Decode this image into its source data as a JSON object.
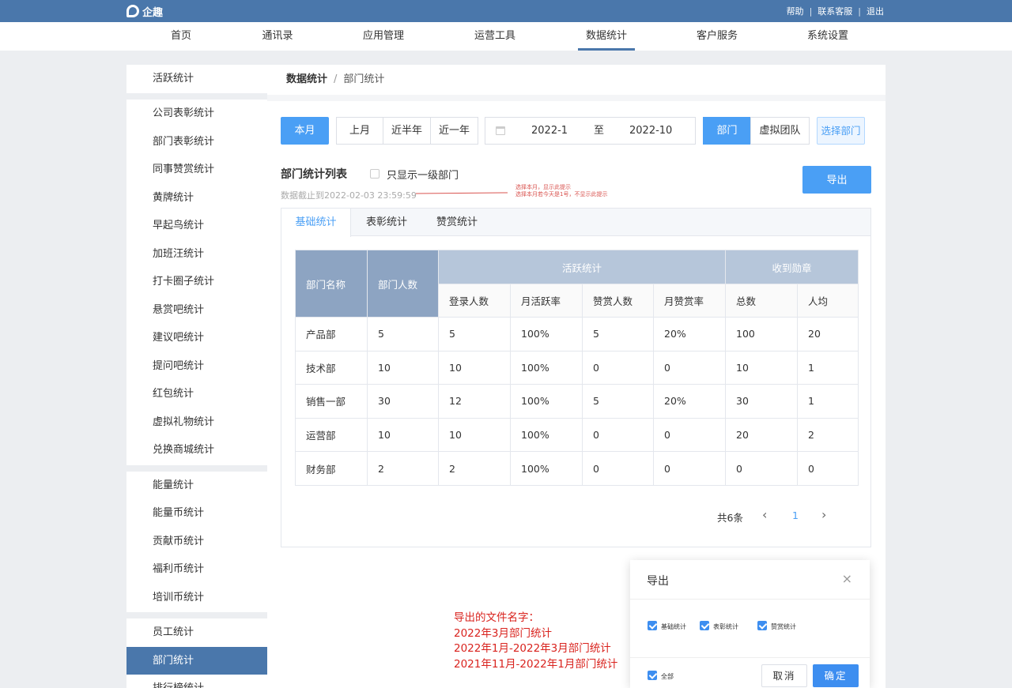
{
  "app": {
    "logo_text": "企趣"
  },
  "top_links": [
    "帮助",
    "联系客服",
    "退出"
  ],
  "nav": [
    "首页",
    "通讯录",
    "应用管理",
    "运营工具",
    "数据统计",
    "客户服务",
    "系统设置"
  ],
  "nav_active": "数据统计",
  "sidebar": {
    "items": [
      "活跃统计",
      "公司表彰统计",
      "部门表彰统计",
      "同事赞赏统计",
      "黄牌统计",
      "早起鸟统计",
      "加班汪统计",
      "打卡圈子统计",
      "悬赏吧统计",
      "建议吧统计",
      "提问吧统计",
      "红包统计",
      "虚拟礼物统计",
      "兑换商城统计",
      "能量统计",
      "能量币统计",
      "贡献币统计",
      "福利币统计",
      "培训币统计",
      "员工统计",
      "部门统计",
      "排行榜统计"
    ],
    "active": "部门统计"
  },
  "breadcrumb": {
    "parent": "数据统计",
    "separator": "/",
    "current": "部门统计"
  },
  "filters": {
    "periods": [
      "本月",
      "上月",
      "近半年",
      "近一年"
    ],
    "active_period": "本月",
    "date_start": "2022-1",
    "date_to": "至",
    "date_end": "2022-10",
    "scope": [
      "部门",
      "虚拟团队"
    ],
    "active_scope": "部门",
    "select_dept": "选择部门"
  },
  "list": {
    "title": "部门统计列表",
    "only_top_level": "只显示一级部门",
    "deadline": "数据截止到2022-02-03 23:59:59",
    "export": "导出",
    "note_line1": "选择本月，显示此提示",
    "note_line2": "选择本月若今天是1号，不显示此提示"
  },
  "tabs": [
    "基础统计",
    "表彰统计",
    "赞赏统计"
  ],
  "active_tab": "基础统计",
  "table": {
    "col_dept": "部门名称",
    "col_count": "部门人数",
    "group_active": "活跃统计",
    "group_medal": "收到勋章",
    "sub_headers": [
      "登录人数",
      "月活跃率",
      "赞赏人数",
      "月赞赏率",
      "总数",
      "人均"
    ],
    "rows": [
      [
        "产品部",
        "5",
        "5",
        "100%",
        "5",
        "20%",
        "100",
        "20"
      ],
      [
        "技术部",
        "10",
        "10",
        "100%",
        "0",
        "0",
        "10",
        "1"
      ],
      [
        "销售一部",
        "30",
        "12",
        "100%",
        "5",
        "20%",
        "30",
        "1"
      ],
      [
        "运营部",
        "10",
        "10",
        "100%",
        "0",
        "0",
        "20",
        "2"
      ],
      [
        "财务部",
        "2",
        "2",
        "100%",
        "0",
        "0",
        "0",
        "0"
      ]
    ]
  },
  "pager": {
    "total": "共6条",
    "prev": "‹",
    "page": "1",
    "next": "›"
  },
  "modal": {
    "title": "导出",
    "close": "×",
    "options": [
      "基础统计",
      "表彰统计",
      "赞赏统计"
    ],
    "all": "全部",
    "cancel": "取消",
    "confirm": "确定"
  },
  "filename_note": [
    "导出的文件名字：",
    "2022年3月部门统计",
    "2022年1月-2022年3月部门统计",
    "2021年11月-2022年1月部门统计"
  ],
  "colors": {
    "header": "#4a77ab",
    "primary": "#4a9ff5",
    "table_head": "#8da4c2",
    "table_group": "#b6c6da",
    "annotation": "#d9231e"
  }
}
